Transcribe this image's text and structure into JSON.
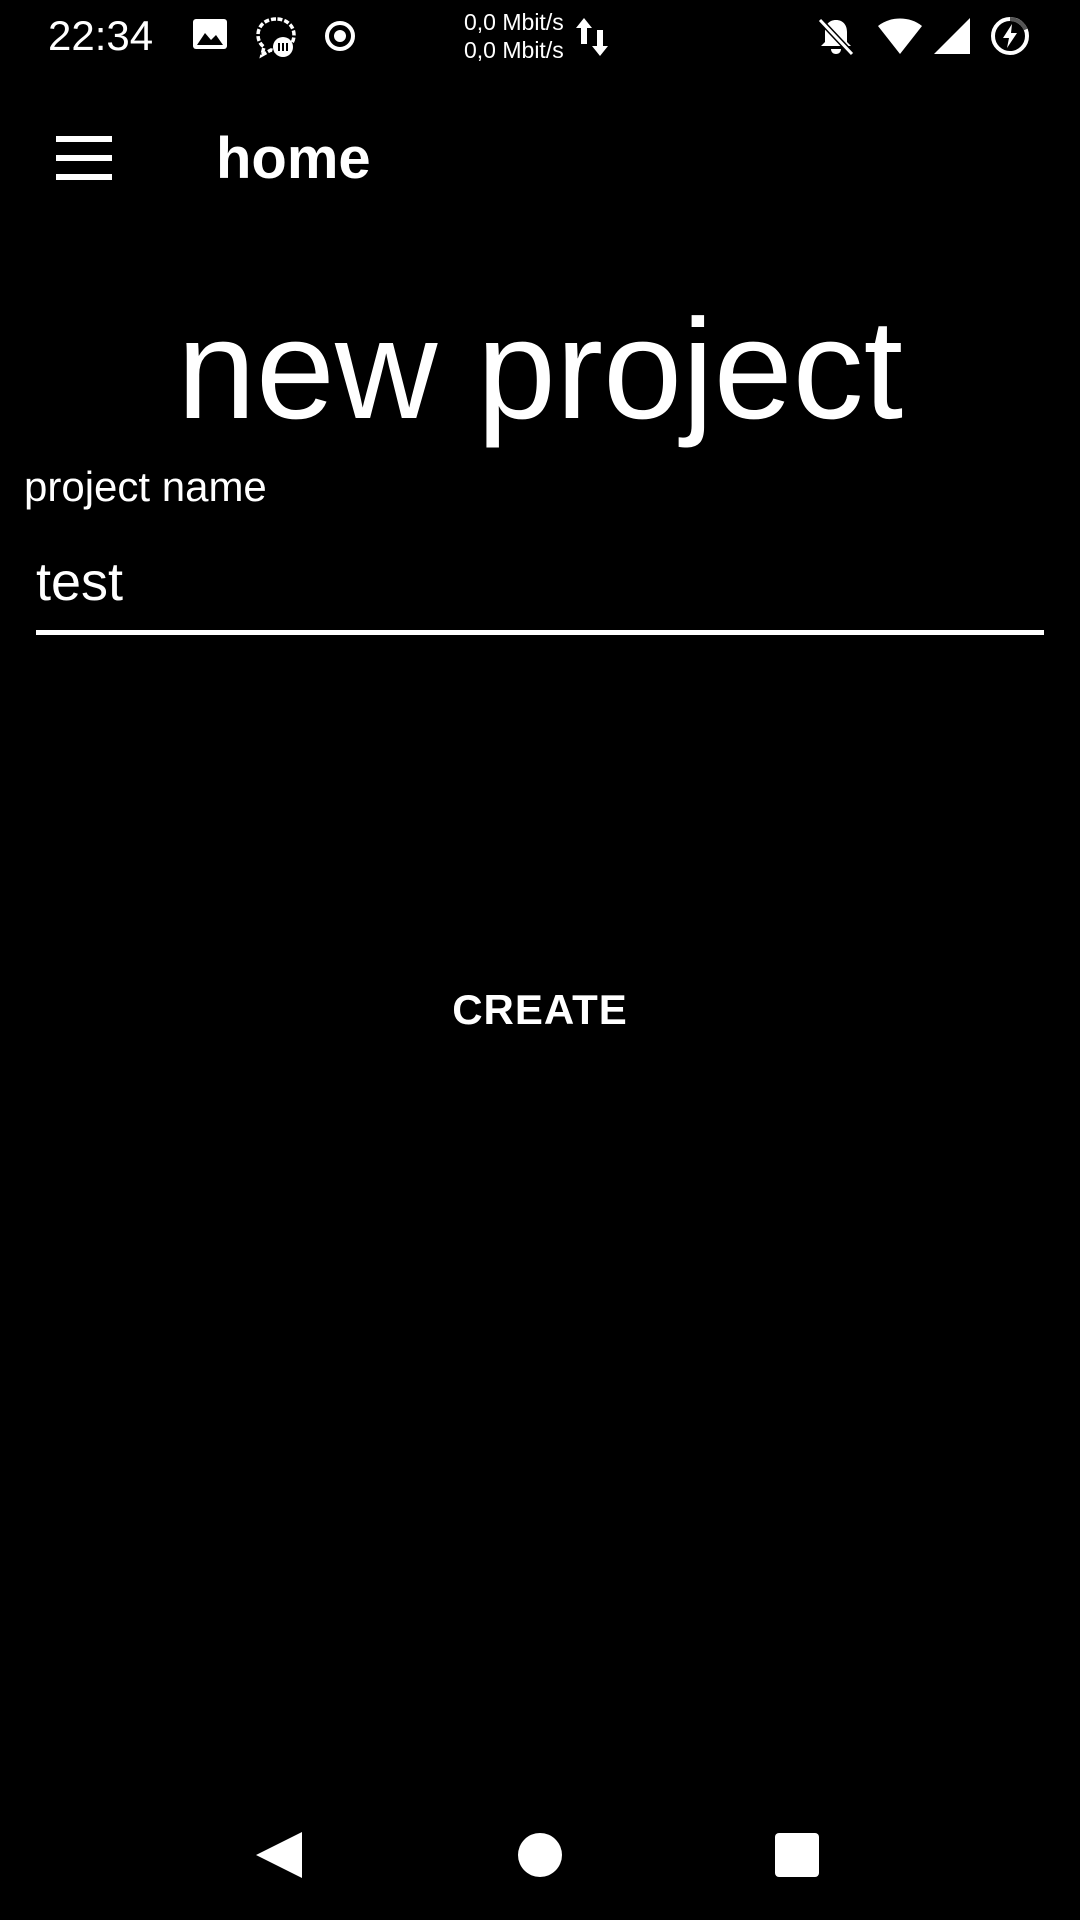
{
  "status_bar": {
    "time": "22:34",
    "upload_speed": "0,0 Mbit/s",
    "download_speed": "0,0 Mbit/s",
    "left_icons": [
      "image-icon",
      "chat-sync-icon",
      "record-icon"
    ],
    "right_icons": [
      "notifications-off-icon",
      "wifi-icon",
      "signal-icon",
      "battery-charging-icon"
    ]
  },
  "app_bar": {
    "title": "home",
    "menu_icon": "hamburger-menu-icon"
  },
  "main": {
    "heading": "new project",
    "field_label": "project name",
    "field_value": "test",
    "create_label": "CREATE"
  },
  "nav_bar": {
    "icons": [
      "back-icon",
      "home-icon",
      "recents-icon"
    ]
  },
  "colors": {
    "background": "#000000",
    "foreground": "#ffffff"
  }
}
